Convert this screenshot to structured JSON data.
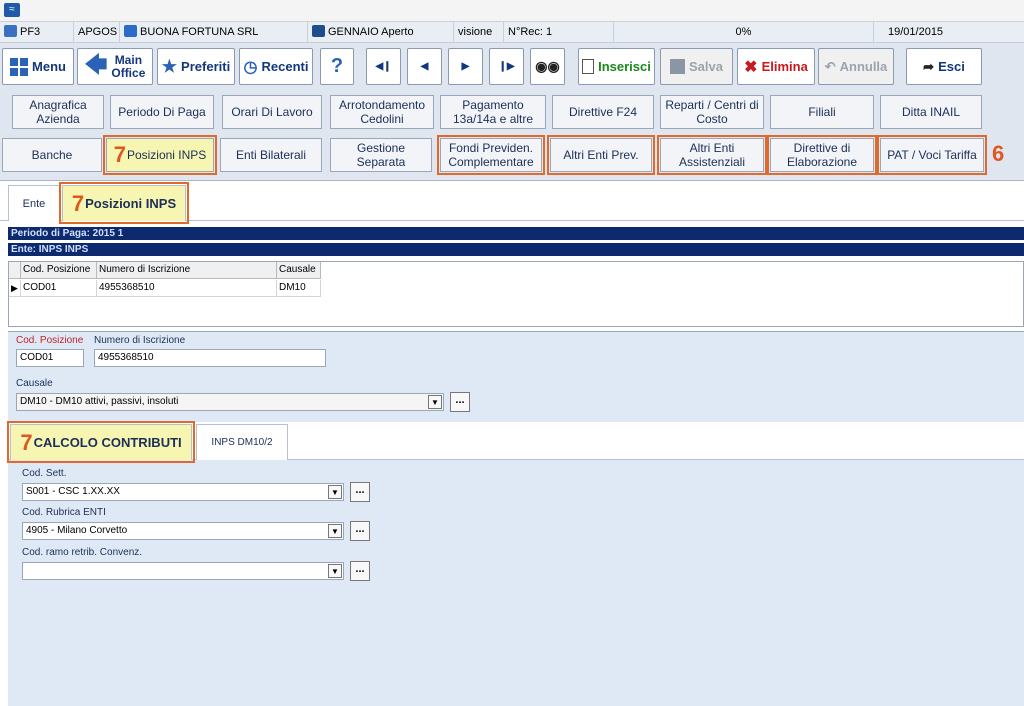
{
  "status": {
    "user": "PF3",
    "company_code": "APGOS",
    "company_name": "BUONA FORTUNA SRL",
    "period": "GENNAIO Aperto",
    "mode": "visione",
    "nrec": "N°Rec: 1",
    "progress": "0%",
    "date": "19/01/2015"
  },
  "toolbar": {
    "menu": "Menu",
    "main_office_1": "Main",
    "main_office_2": "Office",
    "preferiti": "Preferiti",
    "recenti": "Recenti",
    "help": "?",
    "inserisci": "Inserisci",
    "salva": "Salva",
    "elimina": "Elimina",
    "annulla": "Annulla",
    "esci": "Esci"
  },
  "row1": [
    "Anagrafica Azienda",
    "Periodo Di Paga",
    "Orari Di Lavoro",
    "Arrotondamento Cedolini",
    "Pagamento 13a/14a e altre",
    "Direttive F24",
    "Reparti / Centri di Costo",
    "Filiali",
    "Ditta INAIL"
  ],
  "row2": [
    "Banche",
    "Posizioni INPS",
    "Enti Bilaterali",
    "Gestione Separata",
    "Fondi Previden. Complementare",
    "Altri Enti Prev.",
    "Altri Enti Assistenziali",
    "Direttive di Elaborazione",
    "PAT / Voci Tariffa"
  ],
  "annotations": {
    "seven": "7",
    "six": "6"
  },
  "tabs": {
    "ente": "Ente",
    "posizioni": "Posizioni INPS"
  },
  "bars": {
    "periodo": "Periodo di Paga:    2015 1",
    "ente": "Ente:    INPS INPS"
  },
  "grid": {
    "headers": [
      "Cod. Posizione",
      "Numero di Iscrizione",
      "Causale"
    ],
    "row": [
      "COD01",
      "4955368510",
      "DM10"
    ]
  },
  "form": {
    "cod_posizione_label": "Cod. Posizione",
    "numero_label": "Numero di Iscrizione",
    "cod_posizione": "COD01",
    "numero": "4955368510",
    "causale_label": "Causale",
    "causale": "DM10 - DM10 attivi, passivi, insoluti",
    "subtab_calcolo": "CALCOLO CONTRIBUTI",
    "subtab_dm10": "INPS DM10/2",
    "cod_sett_label": "Cod. Sett.",
    "cod_sett": "S001 - CSC 1.XX.XX",
    "rubrica_label": "Cod. Rubrica ENTI",
    "rubrica": "4905 - Milano Corvetto",
    "ramo_label": "Cod. ramo retrib. Convenz.",
    "ramo": "",
    "dots": "..."
  }
}
